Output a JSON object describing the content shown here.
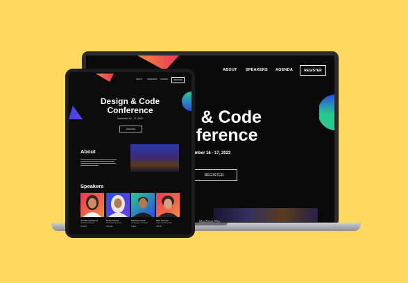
{
  "laptop": {
    "nav": [
      "ABOUT",
      "SPEAKERS",
      "AGENDA"
    ],
    "register_label": "REGISTER",
    "title_line1": "gn & Code",
    "title_line2": "onference",
    "date": "vember 16 - 17, 2023",
    "cta_label": "REGISTER",
    "model_label": "MacBook Pro"
  },
  "tablet": {
    "nav": [
      "ABOUT",
      "SPEAKERS",
      "AGENDA"
    ],
    "register_label": "REGISTER",
    "title_line1": "Design & Code",
    "title_line2": "Conference",
    "date": "November 16 - 17, 2023",
    "cta_label": "REGISTER",
    "about_title": "About",
    "speakers_title": "Speakers",
    "speakers": [
      {
        "name": "Jennifer Rodriguez",
        "role": "VP Product Design",
        "company": "shopify"
      },
      {
        "name": "Nadia Rashid",
        "role": "VP Product & Design",
        "company": "Google"
      },
      {
        "name": "Matthew Carter",
        "role": "UX Designer & Design",
        "company": "Apple"
      },
      {
        "name": "Rich Johnson",
        "role": "Head of UX & Design",
        "company": "Airbnb"
      }
    ]
  },
  "colors": {
    "background": "#FED75D",
    "screen": "#0A0A0B",
    "accent_orange": "#F5883A",
    "accent_pink": "#E9385C",
    "accent_green": "#29C98D",
    "accent_blue": "#2A4DE8"
  }
}
